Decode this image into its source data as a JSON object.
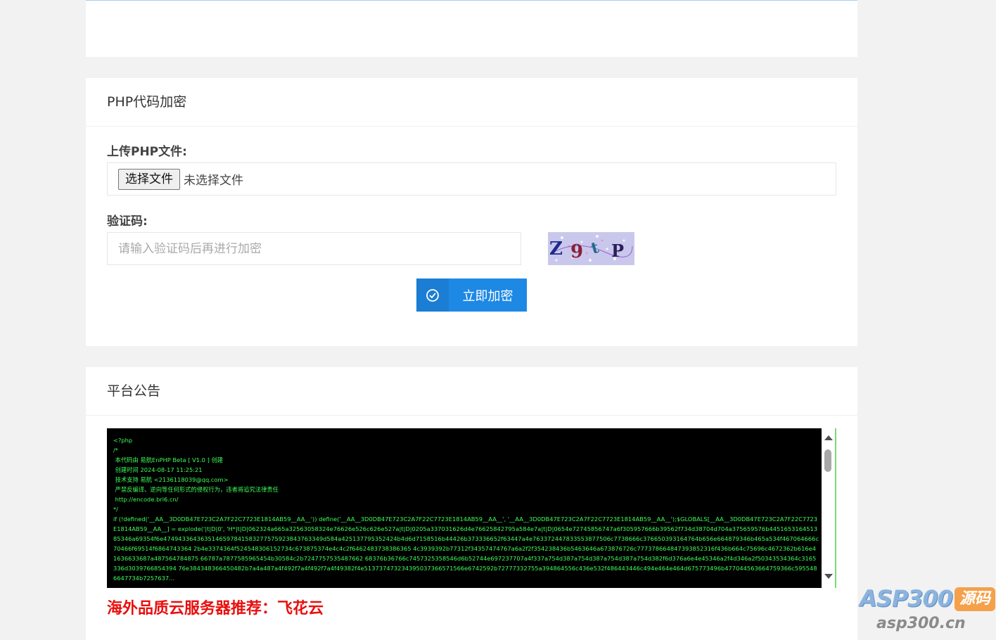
{
  "encrypt_card": {
    "title": "PHP代码加密",
    "upload_label": "上传PHP文件:",
    "file_button": "选择文件",
    "file_status": "未选择文件",
    "captcha_label": "验证码:",
    "captcha_placeholder": "请输入验证码后再进行加密",
    "captcha_text": "Z9tP",
    "submit_label": "立即加密"
  },
  "notice_card": {
    "title": "平台公告",
    "code_text": "<?php\n/*\n 本代码由 易航EnPHP Beta [ V1.0 ] 创建\n 创建时间 2024-08-17 11:25:21\n 技术支持 易航 <2136118039@qq.com>\n 严禁反编译、逆向等任何形式的侵权行为，违者将追究法律责任\n http://encode.bri6.cn/\n*/\nif (!defined('__AA__3D0DB47E723C2A7F22C7723E1814AB59__AA__')) define('__AA__3D0DB47E723C2A7F22C7723E1814AB59__AA__', '__AA__3D0DB47E723C2A7F22C7723E1814AB59__AA__');$GLOBALS[__AA__3D0DB47E723C2A7F22C7723E1814AB59__AA__] = explode('|t|D|0', 'H*|t|D|062324a665a32563058324e76626e526c626e527a|t|D|0205a337031626d4e76625842795a584e7a|t|D|0654e72745856747a6f305957666b39562f734d38704d704a375659576b445165316451385346a69354f6e4749433643635146597841583277575923843763349d584a425137795352424b4d6d7158516b44426b373336652f63447a4e763372447833553877506c7738666c376650393164764b656e664879346b465a534f467064666c70466f69514f6864743364 2b4e3374364f524548306152734c673875374e4c4c2f6462483738386365 4c3939392b77312f34357474767a6a2f2f354238436b5463646a673876726c777378664847393852316f436b664c75696c4672362b616e41636633687a487564784875 66787a7877585965454b30584c2b7247757535487662 68376b36766c7457325358546d6b52744e697237707a4f337a754d387a754d387a754d387a754d382f6d376a6e4e45346a2f4d346a2f50343534364c3165336d3039766854394 76e384348366450482b7a4a487a4f492f7a4f492f7a4f49382f4e513737473234395037366571566e6742592b72777332755a394864556c436e532f486443446c494e464e464d675773496b477044563664759366c5955486647734b7257637..."
  },
  "promo": {
    "text": "海外品质云服务器推荐：飞花云"
  },
  "watermark": {
    "main": "ASP300",
    "badge": "源码",
    "sub": "asp300.cn"
  }
}
